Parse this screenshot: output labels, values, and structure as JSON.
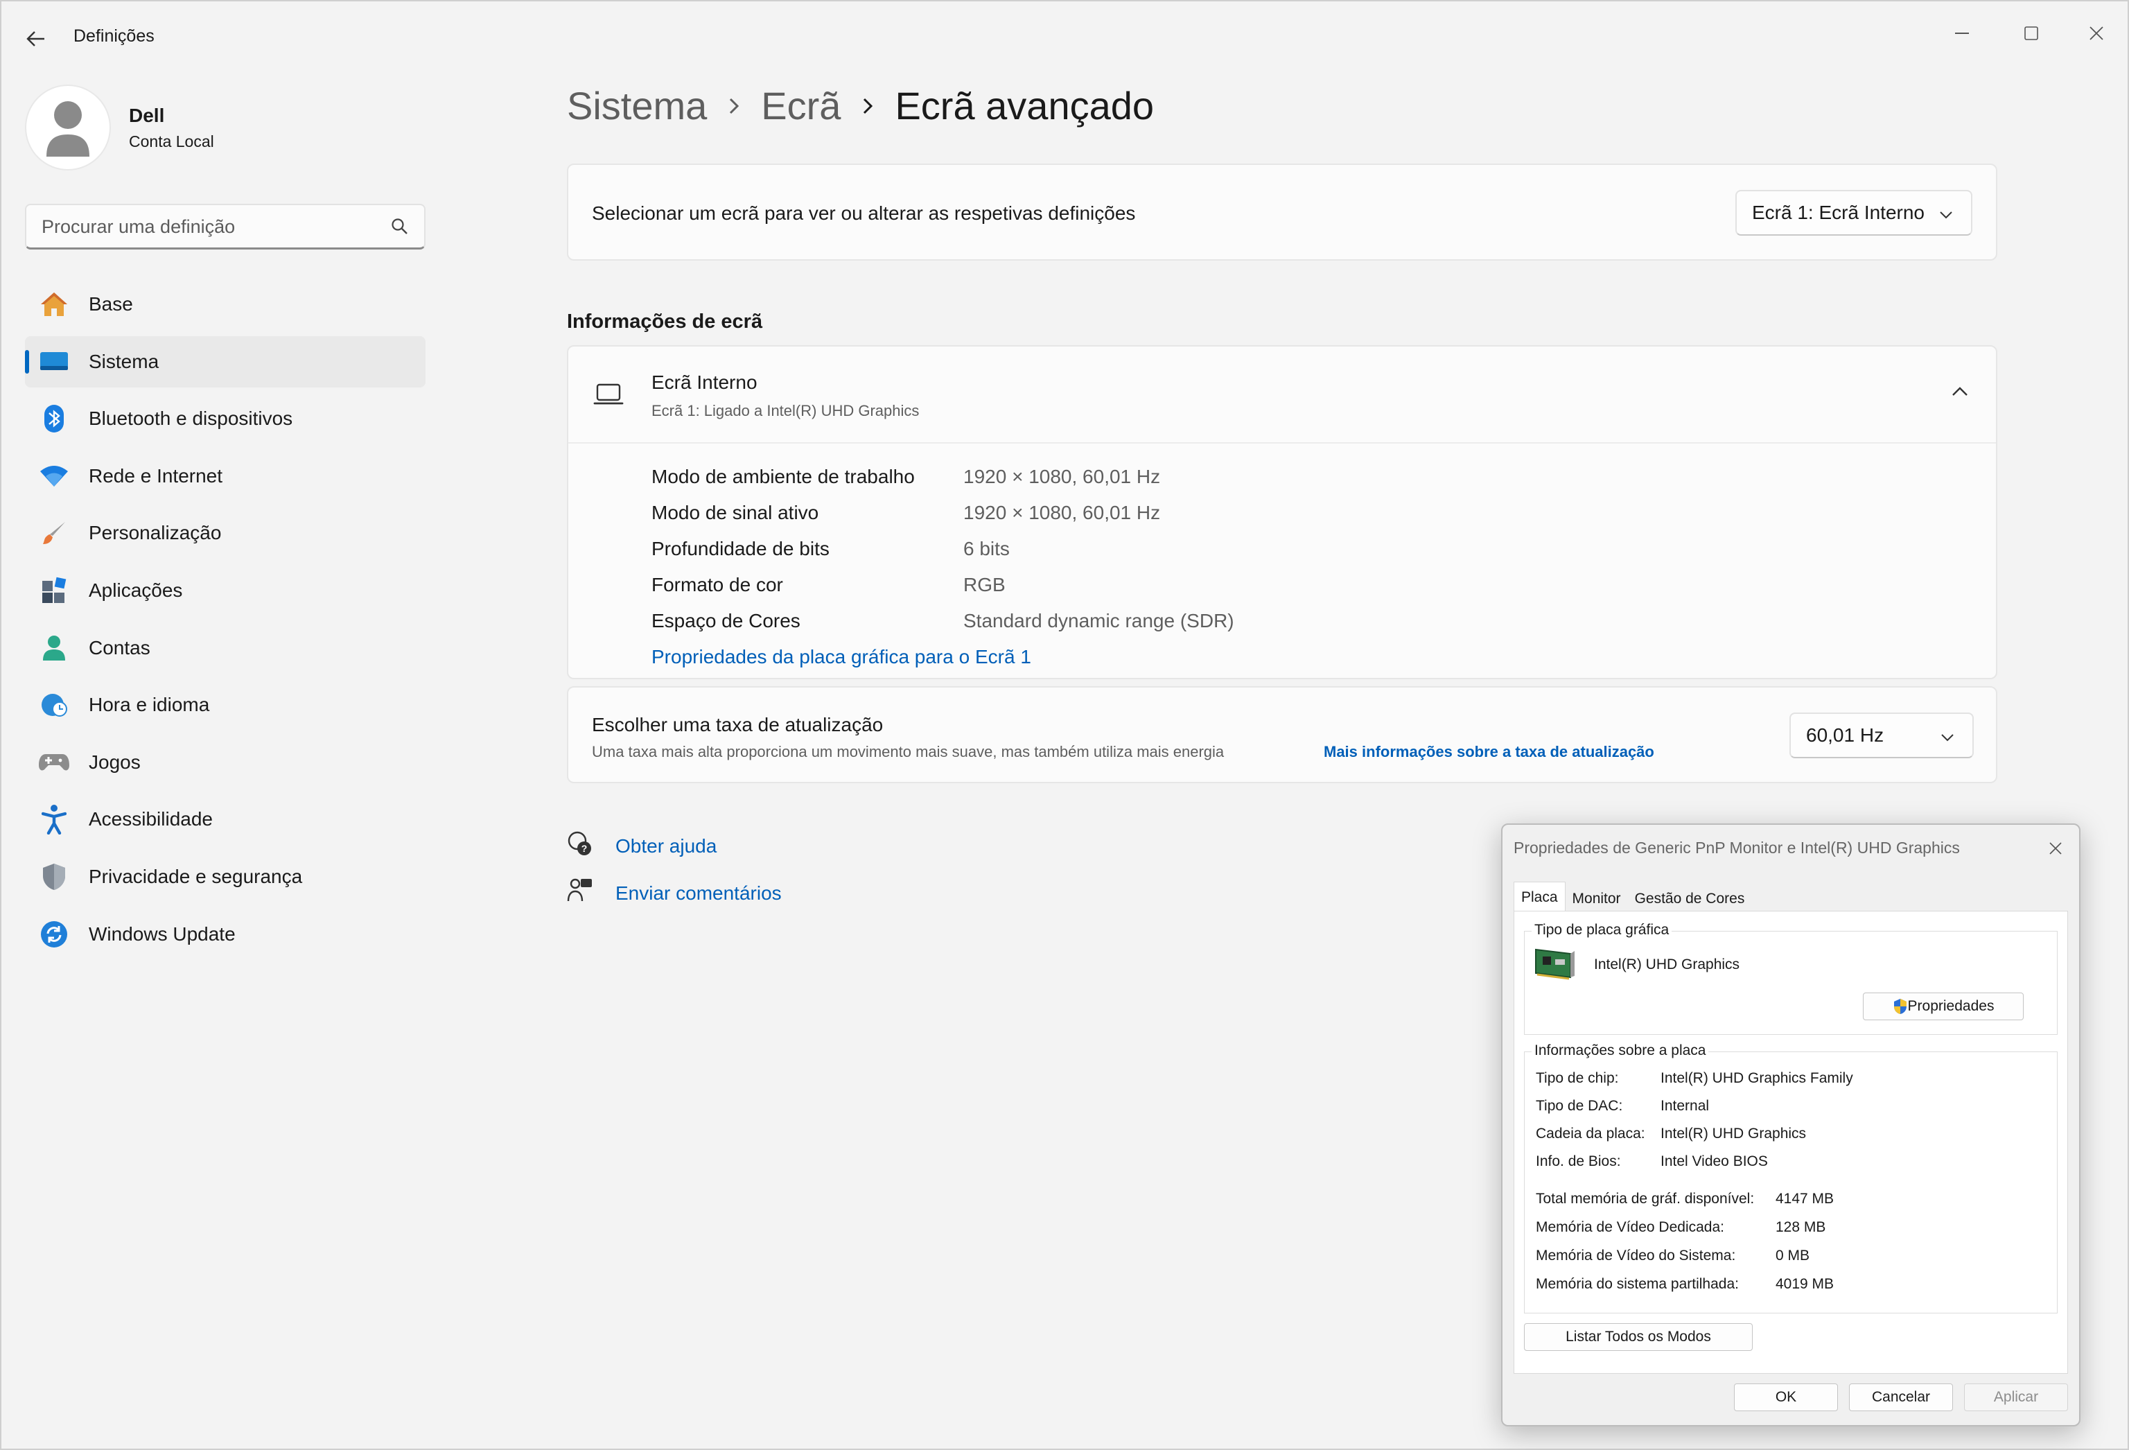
{
  "window": {
    "app_title": "Definições"
  },
  "sidebar": {
    "profile": {
      "name": "Dell",
      "account": "Conta Local"
    },
    "search_placeholder": "Procurar uma definição",
    "items": [
      {
        "label": "Base",
        "icon": "home-icon"
      },
      {
        "label": "Sistema",
        "icon": "system-icon",
        "active": true
      },
      {
        "label": "Bluetooth e dispositivos",
        "icon": "bluetooth-icon"
      },
      {
        "label": "Rede e Internet",
        "icon": "wifi-icon"
      },
      {
        "label": "Personalização",
        "icon": "brush-icon"
      },
      {
        "label": "Aplicações",
        "icon": "apps-icon"
      },
      {
        "label": "Contas",
        "icon": "account-icon"
      },
      {
        "label": "Hora e idioma",
        "icon": "clock-globe-icon"
      },
      {
        "label": "Jogos",
        "icon": "gamepad-icon"
      },
      {
        "label": "Acessibilidade",
        "icon": "accessibility-icon"
      },
      {
        "label": "Privacidade e segurança",
        "icon": "shield-icon"
      },
      {
        "label": "Windows Update",
        "icon": "update-icon"
      }
    ]
  },
  "breadcrumb": [
    "Sistema",
    "Ecrã",
    "Ecrã avançado"
  ],
  "select_display": {
    "text": "Selecionar um ecrã para ver ou alterar as respetivas definições",
    "value": "Ecrã 1: Ecrã Interno"
  },
  "display_info": {
    "section_title": "Informações de ecrã",
    "title": "Ecrã Interno",
    "subtitle": "Ecrã 1: Ligado a Intel(R) UHD Graphics",
    "rows": [
      {
        "key": "Modo de ambiente de trabalho",
        "value": "1920 × 1080, 60,01 Hz"
      },
      {
        "key": "Modo de sinal ativo",
        "value": "1920 × 1080, 60,01 Hz"
      },
      {
        "key": "Profundidade de bits",
        "value": "6 bits"
      },
      {
        "key": "Formato de cor",
        "value": "RGB"
      },
      {
        "key": "Espaço de Cores",
        "value": "Standard dynamic range (SDR)"
      }
    ],
    "adapter_link": "Propriedades da placa gráfica para o Ecrã 1"
  },
  "refresh_rate": {
    "title": "Escolher uma taxa de atualização",
    "desc": "Uma taxa mais alta proporciona um movimento mais suave, mas também utiliza mais energia",
    "link": "Mais informações sobre a taxa de atualização",
    "value": "60,01 Hz"
  },
  "help": {
    "get_help": "Obter ajuda",
    "feedback": "Enviar comentários"
  },
  "dialog": {
    "title": "Propriedades de Generic PnP Monitor e Intel(R) UHD Graphics",
    "tabs": [
      "Placa",
      "Monitor",
      "Gestão de Cores"
    ],
    "adapter_type_group": "Tipo de placa gráfica",
    "adapter_name": "Intel(R) UHD Graphics",
    "properties_button": "Propriedades",
    "adapter_info_group": "Informações sobre a placa",
    "info_rows": [
      {
        "key": "Tipo de chip:",
        "value": "Intel(R) UHD Graphics Family"
      },
      {
        "key": "Tipo de DAC:",
        "value": "Internal"
      },
      {
        "key": "Cadeia da placa:",
        "value": "Intel(R) UHD Graphics"
      },
      {
        "key": "Info. de Bios:",
        "value": "Intel Video BIOS"
      }
    ],
    "memory_rows": [
      {
        "key": "Total memória de gráf. disponível:",
        "value": "4147 MB"
      },
      {
        "key": "Memória de Vídeo Dedicada:",
        "value": "128 MB"
      },
      {
        "key": "Memória de Vídeo do Sistema:",
        "value": "0 MB"
      },
      {
        "key": "Memória do sistema partilhada:",
        "value": "4019 MB"
      }
    ],
    "list_modes_button": "Listar Todos os Modos",
    "ok": "OK",
    "cancel": "Cancelar",
    "apply": "Aplicar"
  },
  "colors": {
    "accent": "#0067c0",
    "link": "#005fb8"
  }
}
